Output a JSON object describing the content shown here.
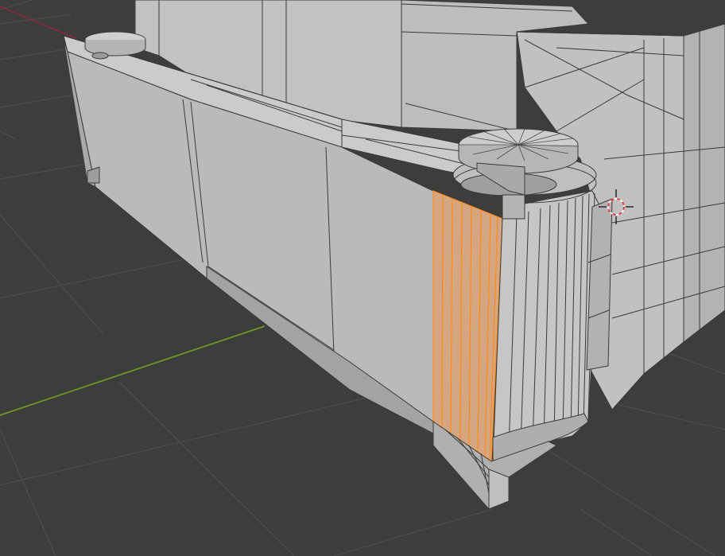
{
  "viewport": {
    "mode": "Edit Mode",
    "shading": "Solid",
    "colors": {
      "background": "#3d3d3d",
      "grid_line": "#4b4b4b",
      "x_axis": "#8a2a3b",
      "y_axis": "#6b9a24",
      "mesh_face": "#b9b9b9",
      "mesh_face_light": "#c4c4c4",
      "mesh_face_dark": "#9e9e9e",
      "wire": "#3a3a3a",
      "selected_face": "#d4a782",
      "selected_edge": "#ff8c1a",
      "cursor_ring_red": "#e23b3b",
      "cursor_ring_white": "#f2f2f2"
    }
  },
  "mesh": {
    "selected_element": "face-strip",
    "selected_edge_loops": 7
  },
  "icons": {
    "cursor": "3d-cursor-icon"
  }
}
